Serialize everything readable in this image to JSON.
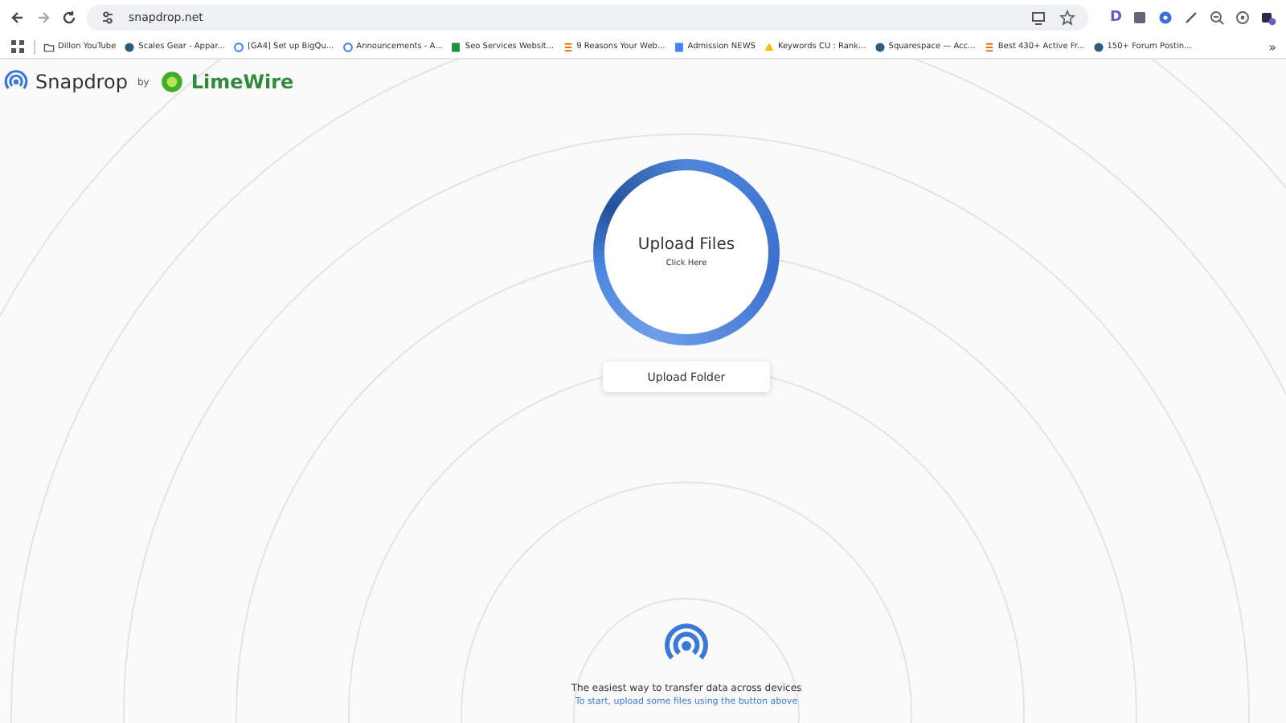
{
  "browser": {
    "url": "snapdrop.net",
    "bookmarks": [
      {
        "label": "Dillon YouTube",
        "kind": "folder"
      },
      {
        "label": "Scales Gear - Appar...",
        "kind": "globe"
      },
      {
        "label": "[GA4] Set up BigQu...",
        "kind": "g"
      },
      {
        "label": "Announcements - A...",
        "kind": "g"
      },
      {
        "label": "Seo Services Websit...",
        "kind": "sheet"
      },
      {
        "label": "9 Reasons Your Web...",
        "kind": "bars"
      },
      {
        "label": "Admission NEWS",
        "kind": "doc"
      },
      {
        "label": "Keywords CU : Rank...",
        "kind": "drive"
      },
      {
        "label": "Squarespace — Acc...",
        "kind": "globe"
      },
      {
        "label": "Best 430+ Active Fr...",
        "kind": "bars"
      },
      {
        "label": "150+ Forum Postin...",
        "kind": "globe"
      }
    ],
    "more_bookmarks": "»",
    "extensions": [
      {
        "kind": "letter",
        "label": "D"
      },
      {
        "kind": "square"
      },
      {
        "kind": "dot"
      },
      {
        "kind": "pen"
      },
      {
        "kind": "zoom"
      },
      {
        "kind": "circle"
      },
      {
        "kind": "puzzle"
      }
    ]
  },
  "header": {
    "brand": "Snapdrop",
    "by": "by",
    "partner": "LimeWire"
  },
  "upload": {
    "title": "Upload Files",
    "subtitle": "Click Here",
    "folder_button": "Upload Folder"
  },
  "footer": {
    "tagline": "The easiest way to transfer data across devices",
    "hint": "To start, upload some files using the button above"
  }
}
